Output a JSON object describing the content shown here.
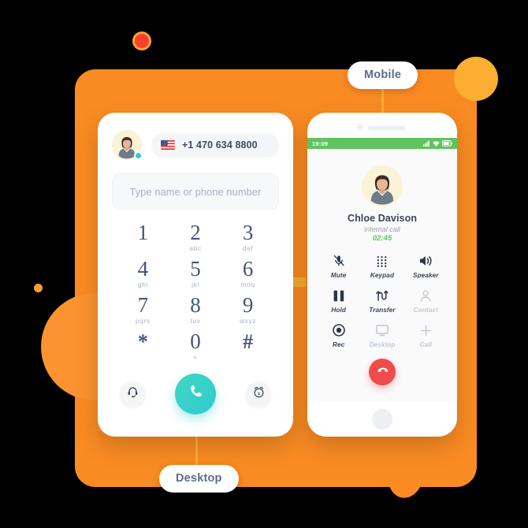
{
  "theme": {
    "panel_orange": "#F98B22",
    "accent_orange": "#FBAE31",
    "red_dot": "#F7412D",
    "teal": "#31C9CE",
    "green": "#5FC45F",
    "red": "#EF4C4C",
    "ink": "#3A4458"
  },
  "callouts": {
    "mobile": "Mobile",
    "desktop": "Desktop"
  },
  "desktop": {
    "avatar_icon": "user-avatar-photo",
    "status_icon": "online-status-dot",
    "flag_icon": "us-flag-icon",
    "phone_number": "+1 470 634 8800",
    "search": {
      "placeholder": "Type name or phone number",
      "value": ""
    },
    "keypad": [
      {
        "digit": "1",
        "letters": ""
      },
      {
        "digit": "2",
        "letters": "abc"
      },
      {
        "digit": "3",
        "letters": "def"
      },
      {
        "digit": "4",
        "letters": "ghi"
      },
      {
        "digit": "5",
        "letters": "jkl"
      },
      {
        "digit": "6",
        "letters": "mno"
      },
      {
        "digit": "7",
        "letters": "pqrs"
      },
      {
        "digit": "8",
        "letters": "tuv"
      },
      {
        "digit": "9",
        "letters": "wxyz"
      },
      {
        "digit": "*",
        "letters": ""
      },
      {
        "digit": "0",
        "letters": "+"
      },
      {
        "digit": "#",
        "letters": ""
      }
    ],
    "actions": {
      "headset_icon": "headset-icon",
      "call_icon": "phone-handset-icon",
      "snooze_icon": "alarm-snooze-icon"
    }
  },
  "mobile": {
    "statusbar": {
      "time": "19:09",
      "signal_icon": "cellular-signal-icon",
      "wifi_icon": "wifi-icon",
      "battery_icon": "battery-icon"
    },
    "call": {
      "avatar_icon": "callee-avatar-photo",
      "name": "Chloe Davison",
      "type": "internal call",
      "duration": "02:45"
    },
    "controls": [
      {
        "label": "Mute",
        "icon": "microphone-muted-icon",
        "disabled": false
      },
      {
        "label": "Keypad",
        "icon": "keypad-grid-icon",
        "disabled": false
      },
      {
        "label": "Speaker",
        "icon": "speaker-icon",
        "disabled": false
      },
      {
        "label": "Hold",
        "icon": "pause-icon",
        "disabled": false
      },
      {
        "label": "Transfer",
        "icon": "transfer-arrows-icon",
        "disabled": false
      },
      {
        "label": "Contact",
        "icon": "contact-person-icon",
        "disabled": true
      },
      {
        "label": "Rec",
        "icon": "record-icon",
        "disabled": false
      },
      {
        "label": "Desktop",
        "icon": "monitor-icon",
        "disabled": true
      },
      {
        "label": "Call",
        "icon": "add-call-plus-icon",
        "disabled": true
      }
    ],
    "hangup_icon": "hangup-handset-icon",
    "home_button_icon": "home-button"
  }
}
